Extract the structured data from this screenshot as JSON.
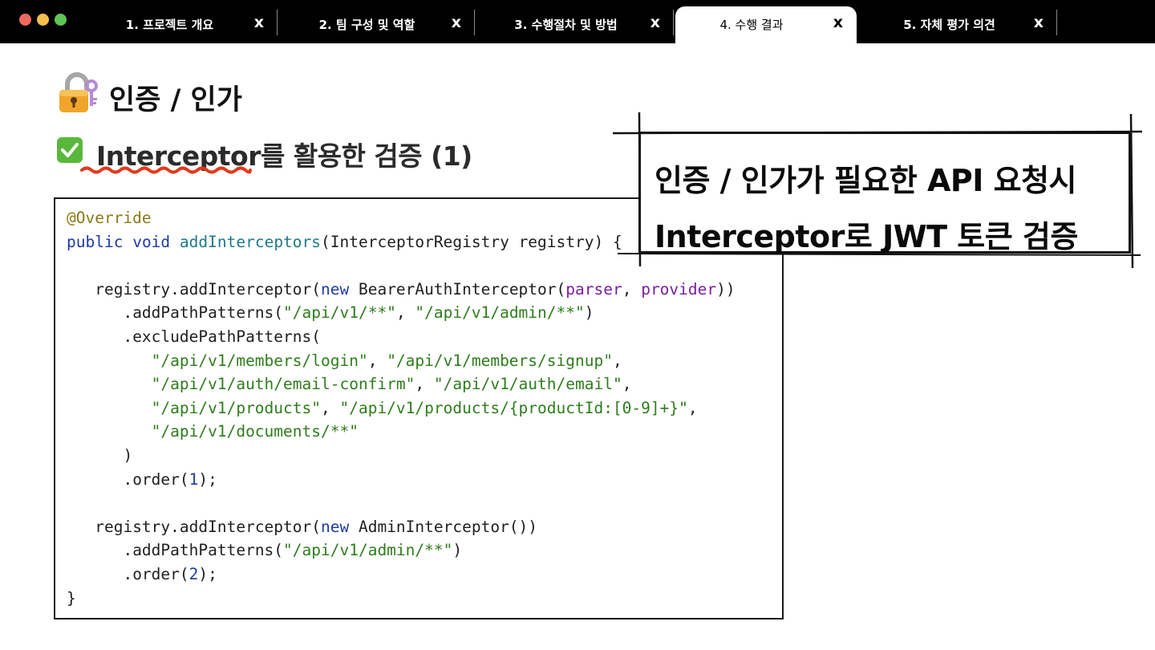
{
  "tabs": [
    {
      "label": "1. 프로젝트 개요",
      "close": "x",
      "active": false
    },
    {
      "label": "2. 팀 구성 및 역할",
      "close": "x",
      "active": false
    },
    {
      "label": "3. 수행절차 및 방법",
      "close": "x",
      "active": false
    },
    {
      "label": "4. 수행 결과",
      "close": "x",
      "active": true
    },
    {
      "label": "5. 자체 평가 의견",
      "close": "x",
      "active": false
    }
  ],
  "heading": {
    "title": "인증 / 인가",
    "icon": "lock-with-key-icon"
  },
  "subheading": {
    "keyword": "Interceptor",
    "rest": "를 활용한 검증 (1)",
    "icon": "checkmark-box-icon"
  },
  "callout": {
    "line1": "인증 / 인가가 필요한 API 요청시",
    "line2": "Interceptor로 JWT 토큰 검증"
  },
  "code": {
    "l1_annotation": "@Override",
    "l2_kw_public": "public",
    "l2_kw_void": "void",
    "l2_method": "addInterceptors",
    "l2_rest": "(InterceptorRegistry registry) {",
    "l4_a": "registry.addInterceptor(",
    "l4_kw_new": "new",
    "l4_b": " BearerAuthInterceptor(",
    "l4_p1": "parser",
    "l4_c": ", ",
    "l4_p2": "provider",
    "l4_d": "))",
    "l5_a": ".addPathPatterns(",
    "l5_s1": "\"/api/v1/**\"",
    "l5_b": ", ",
    "l5_s2": "\"/api/v1/admin/**\"",
    "l5_c": ")",
    "l6": ".excludePathPatterns(",
    "l7_s1": "\"/api/v1/members/login\"",
    "l7_b": ", ",
    "l7_s2": "\"/api/v1/members/signup\"",
    "l7_c": ",",
    "l8_s1": "\"/api/v1/auth/email-confirm\"",
    "l8_b": ", ",
    "l8_s2": "\"/api/v1/auth/email\"",
    "l8_c": ",",
    "l9_s1": "\"/api/v1/products\"",
    "l9_b": ", ",
    "l9_s2": "\"/api/v1/products/{productId:[0-9]+}\"",
    "l9_c": ",",
    "l10_s1": "\"/api/v1/documents/**\"",
    "l11": ")",
    "l12_a": ".order(",
    "l12_n": "1",
    "l12_b": ");",
    "l14_a": "registry.addInterceptor(",
    "l14_kw_new": "new",
    "l14_b": " AdminInterceptor())",
    "l15_a": ".addPathPatterns(",
    "l15_s1": "\"/api/v1/admin/**\"",
    "l15_b": ")",
    "l16_a": ".order(",
    "l16_n": "2",
    "l16_b": ");",
    "l17": "}"
  },
  "colors": {
    "annotation": "#8a7a18",
    "keyword": "#1d3aa7",
    "method": "#1f7a88",
    "string": "#2e7d1c",
    "param": "#7a1fa2",
    "squiggle": "#e03a1c"
  }
}
